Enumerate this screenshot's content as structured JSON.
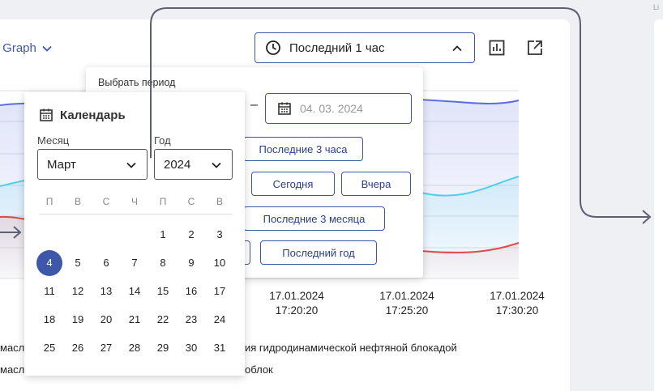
{
  "header": {
    "graph_title": "r Graph",
    "period_value": "Последний 1 час",
    "side_label": "Li"
  },
  "chart_data": {
    "type": "line",
    "x": [
      "17.01.2024 17:20:20",
      "17.01.2024 17:25:20",
      "17.01.2024 17:30:20"
    ],
    "series": [
      {
        "color": "#5b6fe0"
      },
      {
        "color": "#4fd0ea"
      },
      {
        "color": "#e04848"
      }
    ]
  },
  "xticks": [
    {
      "date": "17.01.2024",
      "time": "17:20:20"
    },
    {
      "date": "17.01.2024",
      "time": "17:25:20"
    },
    {
      "date": "17.01.2024",
      "time": "17:30:20"
    }
  ],
  "legend": {
    "row1_left": "масл",
    "row1_right": "ия гидродинамической нефтяной блокадой",
    "row2_left": "масл",
    "row2_right": "облок"
  },
  "period_panel": {
    "label": "Выбрать период",
    "end_date": "04. 03. 2024",
    "buttons": {
      "last3h": "Последние 3 часа",
      "today": "Сегодня",
      "yesterday": "Вчера",
      "last3m": "Последние 3 месяца",
      "last_year": "Последний год"
    }
  },
  "calendar": {
    "title": "Календарь",
    "month_label": "Месяц",
    "year_label": "Год",
    "month_value": "Март",
    "year_value": "2024",
    "weekdays": [
      "П",
      "В",
      "С",
      "Ч",
      "П",
      "С",
      "В"
    ],
    "selected_day": "4",
    "weeks": [
      [
        "",
        "",
        "",
        "",
        "1",
        "2",
        "3"
      ],
      [
        "4",
        "5",
        "6",
        "7",
        "8",
        "9",
        "10"
      ],
      [
        "11",
        "12",
        "13",
        "14",
        "15",
        "16",
        "17"
      ],
      [
        "18",
        "19",
        "20",
        "21",
        "22",
        "23",
        "24"
      ],
      [
        "25",
        "26",
        "27",
        "28",
        "29",
        "30",
        "31"
      ]
    ]
  },
  "colors": {
    "accent": "#3f57a8",
    "series_blue": "#5b6fe0",
    "series_cyan": "#4fd0ea",
    "series_red": "#e04848"
  }
}
